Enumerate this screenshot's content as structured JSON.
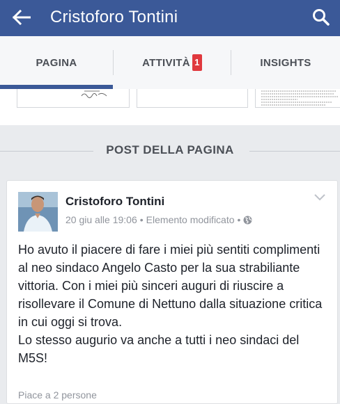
{
  "header": {
    "title": "Cristoforo Tontini",
    "back_icon": "arrow-left-icon",
    "search_icon": "search-icon",
    "bg_color": "#3b5998"
  },
  "tabs": [
    {
      "label": "PAGINA",
      "active": true
    },
    {
      "label": "ATTIVITÀ",
      "badge": "1"
    },
    {
      "label": "INSIGHTS"
    }
  ],
  "section": {
    "title": "POST DELLA PAGINA"
  },
  "post": {
    "author": "Cristoforo Tontini",
    "date": "20 giu alle 19:06",
    "edited": "Elemento modificato",
    "separator": "•",
    "privacy_icon": "globe-icon",
    "text": "Ho avuto il piacere di fare i miei più sentiti complimenti al neo sindaco Angelo Casto per la sua strabiliante vittoria. Con i miei più sinceri auguri di riuscire a risollevare il Comune di Nettuno dalla situazione critica in cui oggi si trova.\nLo stesso augurio va anche a tutti i neo sindaci del M5S!",
    "likes": "Piace a 2 persone"
  }
}
